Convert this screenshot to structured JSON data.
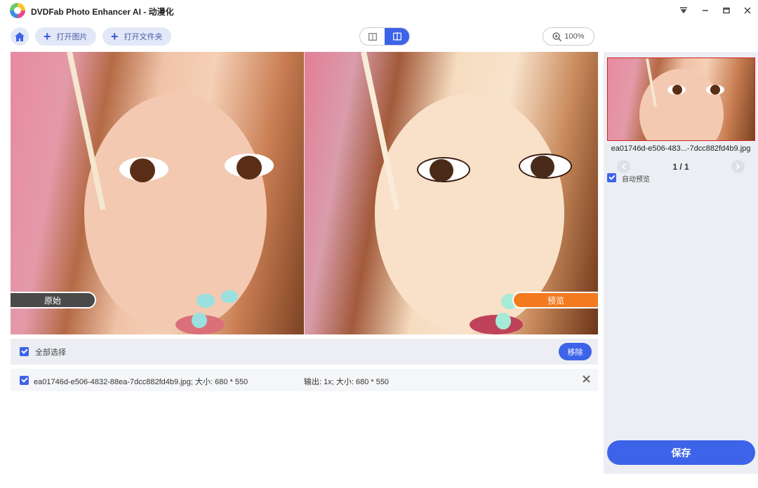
{
  "window": {
    "title": "DVDFab Photo Enhancer AI - 动漫化",
    "controls": {
      "menu_icon": "dropdown-menu-icon",
      "minimize": "—",
      "maximize": "▭",
      "close": "✕"
    }
  },
  "toolbar": {
    "open_image_label": "打开图片",
    "open_folder_label": "打开文件夹",
    "zoom_label": "100%"
  },
  "viewer": {
    "original_label": "原始",
    "preview_label": "预览"
  },
  "file_list": {
    "select_all_label": "全部选择",
    "remove_label": "移除",
    "items": [
      {
        "name": "ea01746d-e506-4832-88ea-7dcc882fd4b9.jpg; 大小: 680 * 550",
        "output": "输出: 1x; 大小: 680 * 550",
        "checked": true
      }
    ]
  },
  "right_panel": {
    "thumb_name": "ea01746d-e506-483...-7dcc882fd4b9.jpg",
    "page_indicator": "1 / 1",
    "auto_preview_label": "自动预览",
    "save_label": "保存"
  },
  "colors": {
    "accent": "#3d63e8",
    "preview_tag": "#f47a1f",
    "original_tag": "#4a4a4a",
    "panel_bg": "#eceef3"
  }
}
